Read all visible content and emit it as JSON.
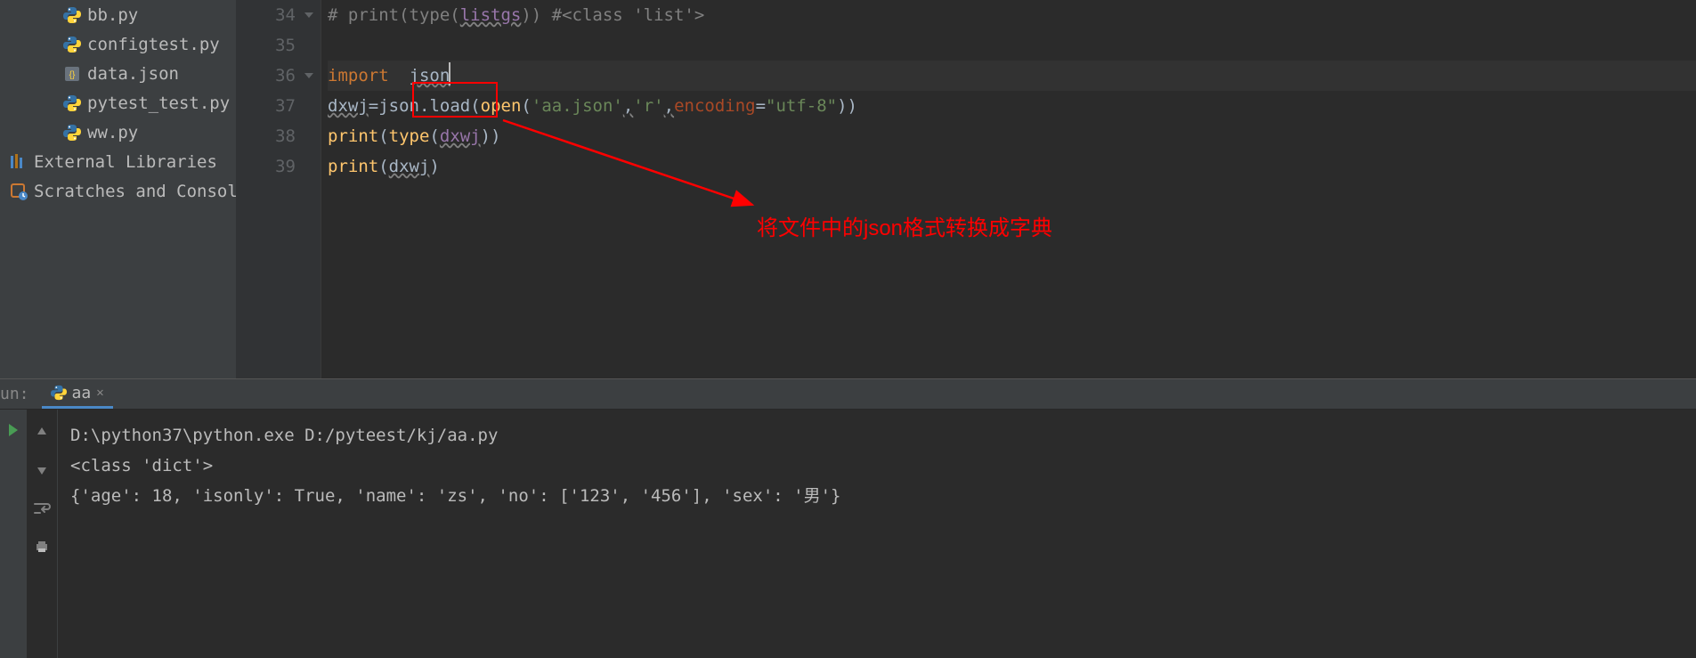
{
  "sidebar": {
    "files": [
      {
        "name": "bb.py",
        "icon": "py"
      },
      {
        "name": "configtest.py",
        "icon": "py"
      },
      {
        "name": "data.json",
        "icon": "json"
      },
      {
        "name": "pytest_test.py",
        "icon": "py"
      },
      {
        "name": "ww.py",
        "icon": "py"
      }
    ],
    "external": "External Libraries",
    "scratches": "Scratches and Consoles"
  },
  "editor": {
    "lines": {
      "34": {
        "comment": "# print(type(",
        "ident": "listgs",
        "comment_mid": ")) #<class 'list'>"
      },
      "35": {},
      "36": {
        "import_kw": "import",
        "import_mod": "json"
      },
      "37": {
        "lhs": "dxwj",
        "eq": "=",
        "obj": "json",
        "dot": ".",
        "fn": "load",
        "paren_o": "(",
        "open_fn": "open",
        "p2": "(",
        "s1": "'aa.json'",
        "c1": ",",
        "s2": "'r'",
        "c2": ",",
        "kwarg": "encoding",
        "eq2": "=",
        "s3": "\"utf-8\"",
        "close": "))"
      },
      "38": {
        "fn1": "print",
        "p": "(",
        "fn2": "type",
        "p2": "(",
        "ident": "dxwj",
        "close": "))"
      },
      "39": {
        "fn1": "print",
        "p": "(",
        "ident": "dxwj",
        "close": ")"
      }
    },
    "line_numbers": [
      "34",
      "35",
      "36",
      "37",
      "38",
      "39"
    ]
  },
  "annotations": {
    "note": "将文件中的json格式转换成字典"
  },
  "run_tool": {
    "label": "un:",
    "tab_name": "aa"
  },
  "console": {
    "lines": [
      "D:\\python37\\python.exe D:/pyteest/kj/aa.py",
      "<class 'dict'>",
      "{'age': 18, 'isonly': True, 'name': 'zs', 'no': ['123', '456'], 'sex': '男'}"
    ]
  }
}
